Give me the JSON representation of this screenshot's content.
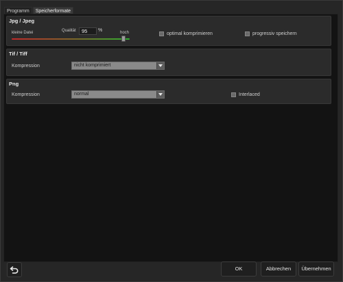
{
  "tabs": [
    {
      "label": "Programm",
      "active": false
    },
    {
      "label": "Speicherformate",
      "active": true
    }
  ],
  "jpg": {
    "title": "Jpg / Jpeg",
    "small_file_label": "kleine Datei",
    "quality_label": "Qualität",
    "quality_value": "95",
    "percent": "%",
    "high_label": "hoch",
    "quality_fraction": 0.95,
    "optimal_label": "optimal komprimieren",
    "optimal_checked": false,
    "progressive_label": "progressiv speichern",
    "progressive_checked": false
  },
  "tif": {
    "title": "Tif / Tiff",
    "compression_label": "Kompression",
    "compression_value": "nicht komprimiert"
  },
  "png": {
    "title": "Png",
    "compression_label": "Kompression",
    "compression_value": "normal",
    "interlaced_label": "Interlaced",
    "interlaced_checked": false
  },
  "footer": {
    "reset_icon": "undo-arrow-icon",
    "ok_label": "OK",
    "cancel_label": "Abbrechen",
    "apply_label": "Übernehmen"
  },
  "colors": {
    "slider_low": "#c22a2a",
    "slider_high": "#2fb02f",
    "panel": "#2b2b2b",
    "background": "#131313"
  }
}
